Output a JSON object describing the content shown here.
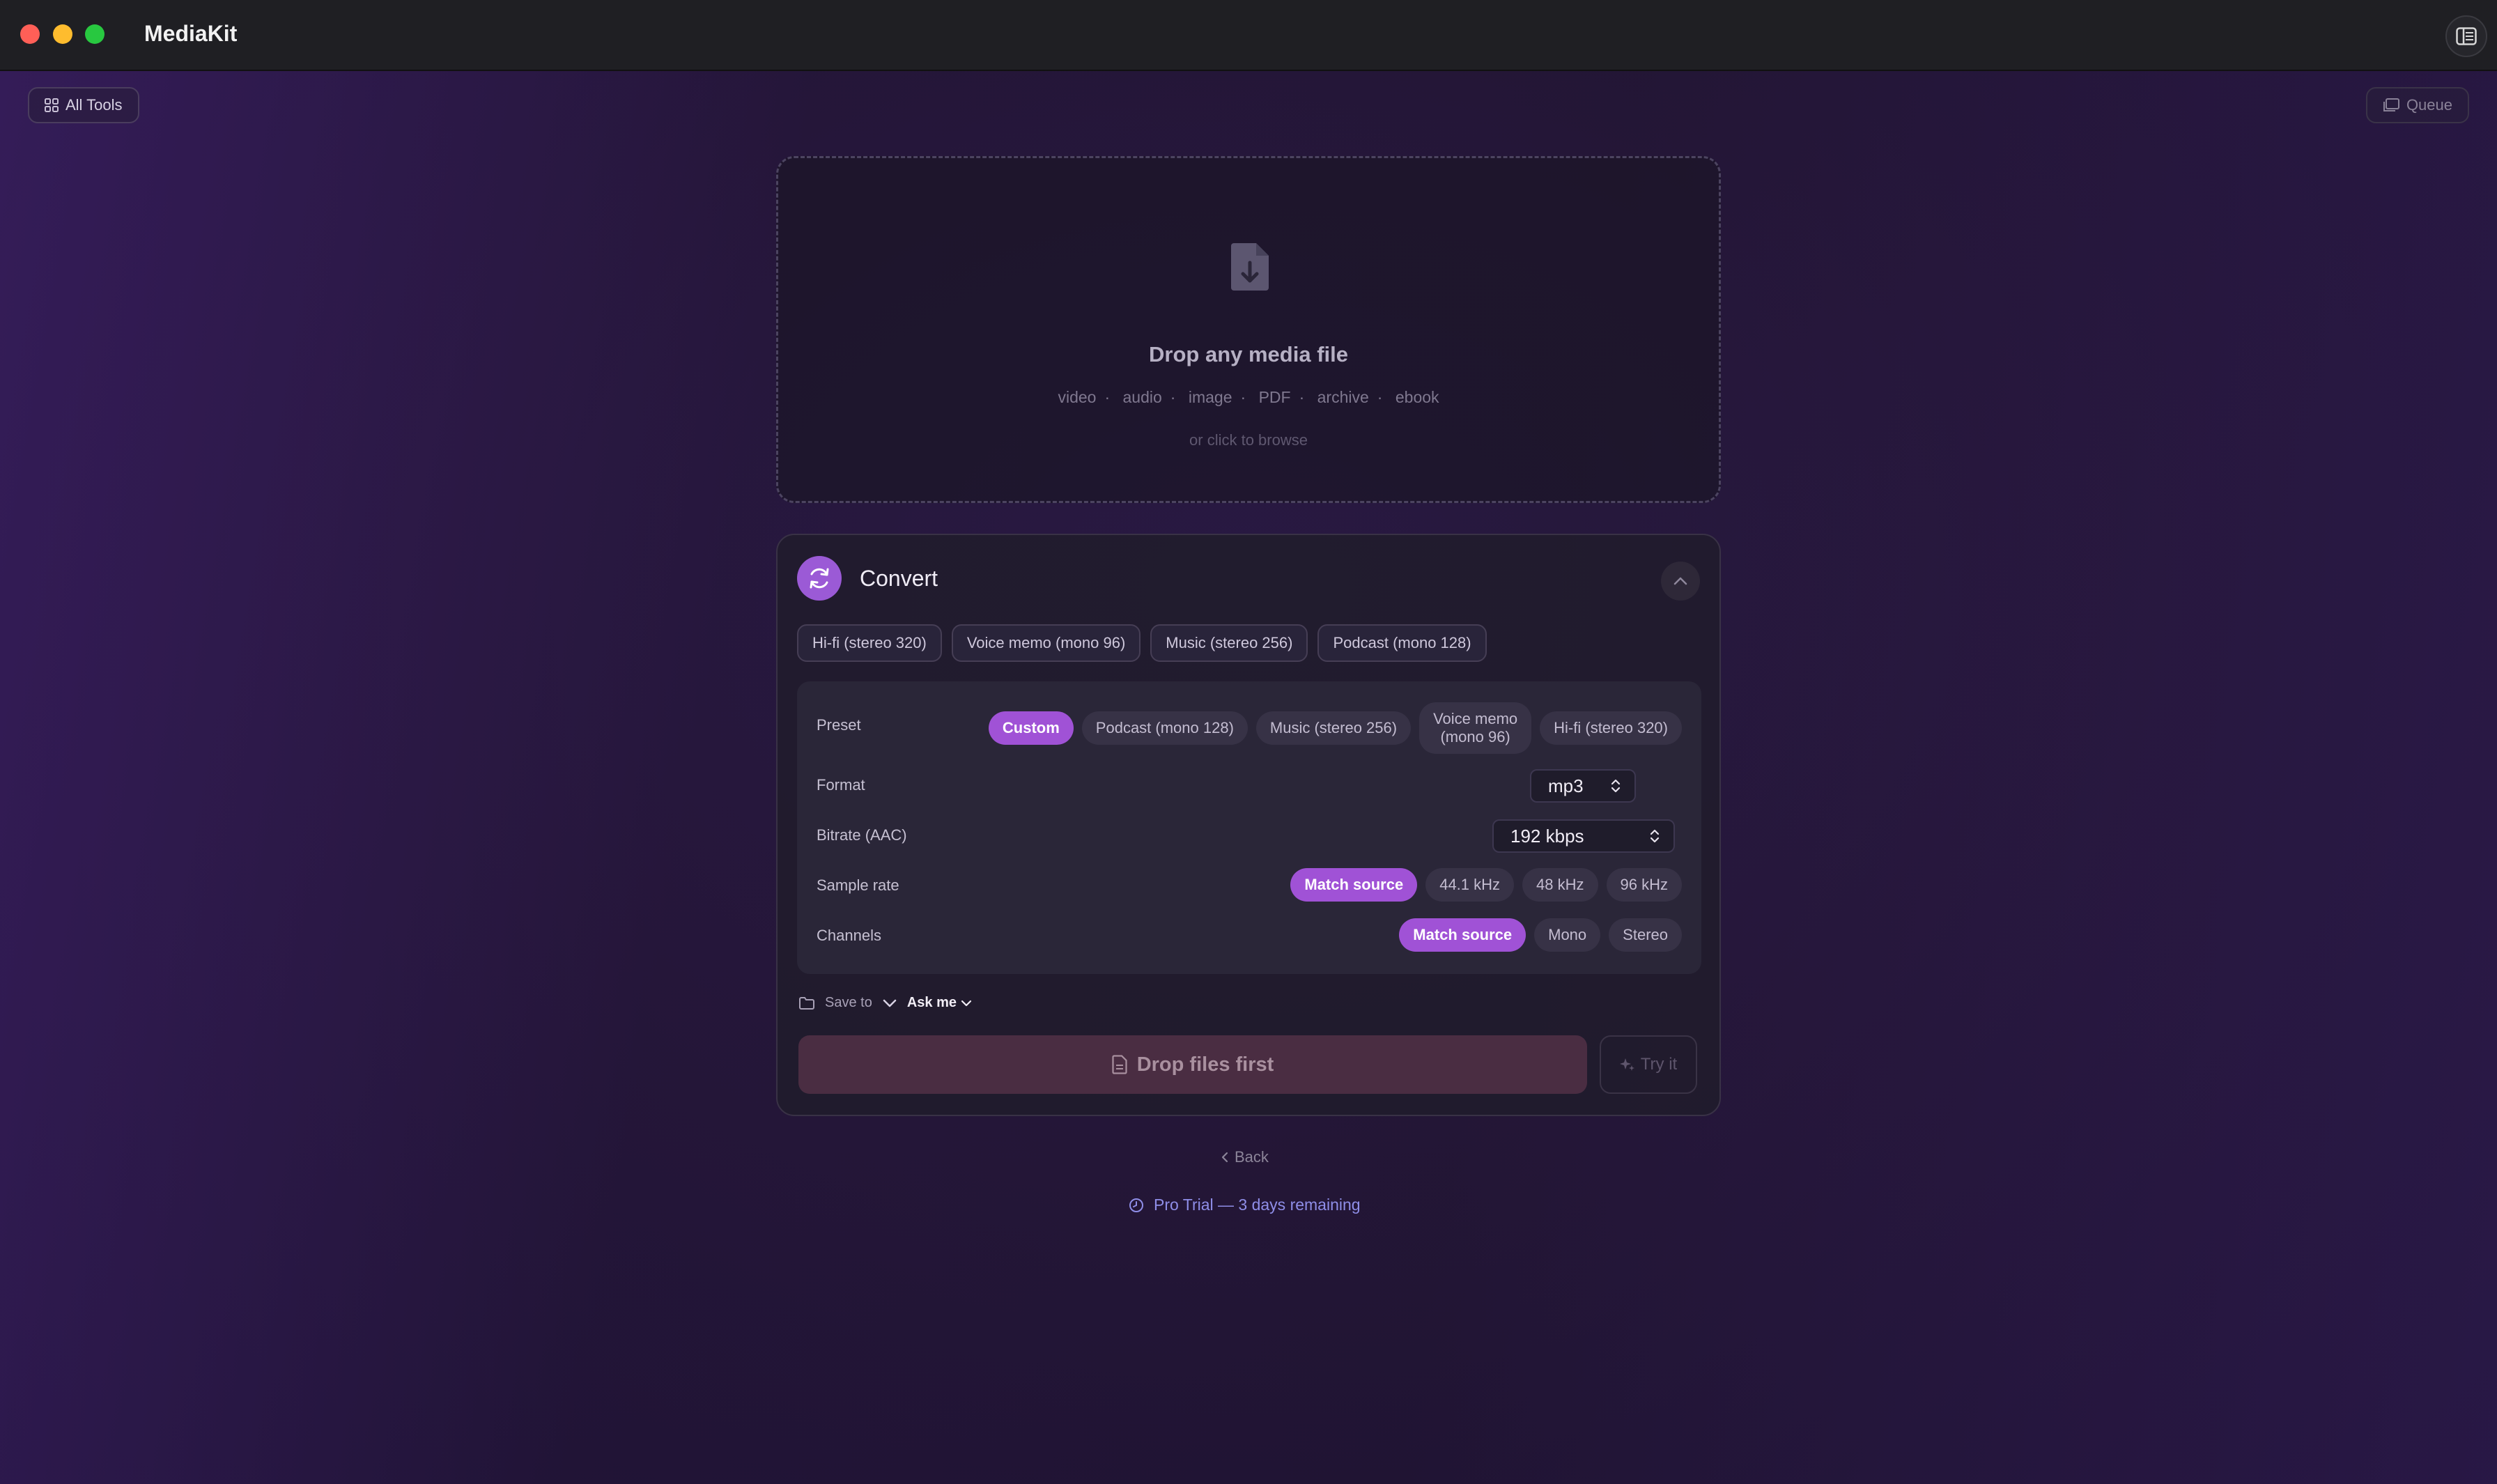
{
  "app": {
    "title": "MediaKit"
  },
  "toolbar": {
    "all_tools_label": "All Tools",
    "queue_label": "Queue"
  },
  "dropzone": {
    "title": "Drop any media file",
    "types": [
      "video",
      "audio",
      "image",
      "PDF",
      "archive",
      "ebook"
    ],
    "separator": "·",
    "subtitle": "or click to browse"
  },
  "convert": {
    "title": "Convert",
    "quick_presets": [
      "Hi-fi (stereo 320)",
      "Voice memo (mono 96)",
      "Music (stereo 256)",
      "Podcast (mono 128)"
    ],
    "preset": {
      "label": "Preset",
      "options": [
        {
          "line1": "Custom",
          "line2": "",
          "active": true
        },
        {
          "line1": "Podcast (mono 128)",
          "line2": "",
          "active": false
        },
        {
          "line1": "Music (stereo 256)",
          "line2": "",
          "active": false
        },
        {
          "line1": "Voice memo",
          "line2": "(mono 96)",
          "active": false
        },
        {
          "line1": "Hi-fi (stereo 320)",
          "line2": "",
          "active": false
        }
      ]
    },
    "format": {
      "label": "Format",
      "value": "mp3"
    },
    "bitrate": {
      "label": "Bitrate (AAC)",
      "value": "192 kbps"
    },
    "sample_rate": {
      "label": "Sample rate",
      "options": [
        "Match source",
        "44.1 kHz",
        "48 kHz",
        "96 kHz"
      ],
      "selected": "Match source"
    },
    "channels": {
      "label": "Channels",
      "options": [
        "Match source",
        "Mono",
        "Stereo"
      ],
      "selected": "Match source"
    },
    "save_to": {
      "label": "Save to",
      "value": "Ask me"
    },
    "action_label": "Drop files first",
    "try_label": "Try it"
  },
  "footer": {
    "back_label": "Back",
    "trial_text": "Pro Trial — 3 days remaining"
  },
  "colors": {
    "accent": "#a052d6",
    "close": "#ff5f57",
    "minimize": "#febc2e",
    "zoom": "#28c840",
    "trial": "#8f8ee8"
  }
}
